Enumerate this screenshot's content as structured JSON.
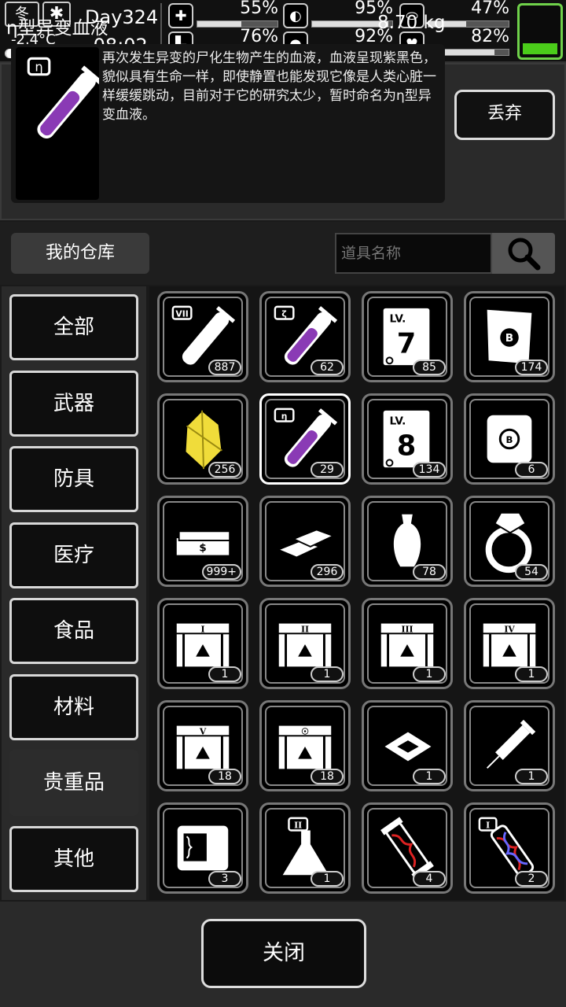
{
  "status": {
    "season": "冬",
    "weather_icon": "snowflake-icon",
    "temperature": "-2.4°C",
    "day": "Day324",
    "time": "-08:02-",
    "stats": [
      {
        "icon": "medkit-icon",
        "label": "55%",
        "level": 0.55
      },
      {
        "icon": "stomach-icon",
        "label": "95%",
        "level": 0.95
      },
      {
        "icon": "pill-icon",
        "label": "47%",
        "level": 0.47
      },
      {
        "icon": "boot-icon",
        "label": "76%",
        "level": 0.76
      },
      {
        "icon": "water-drop-icon",
        "label": "92%",
        "level": 0.92
      },
      {
        "icon": "heart-icon",
        "label": "82%",
        "level": 0.82
      }
    ],
    "battery_level": 0.25,
    "battery_color": "#4bcc1a"
  },
  "detail": {
    "name": "η型异变血液",
    "weight": "8.70 kg",
    "description": "再次发生异变的尸化生物产生的血液，血液呈现紫黑色，貌似具有生命一样，即使静置也能发现它像是人类心脏一样缓缓跳动，目前对于它的研究太少，暂时命名为η型异变血液。",
    "discard_label": "丢弃"
  },
  "warehouse": {
    "title": "我的仓库",
    "search_placeholder": "道具名称"
  },
  "categories": [
    "全部",
    "武器",
    "防具",
    "医疗",
    "食品",
    "材料",
    "贵重品",
    "其他"
  ],
  "active_category": "贵重品",
  "items": [
    {
      "icon": "vial-vii-icon",
      "count": "887"
    },
    {
      "icon": "vial-zeta-icon",
      "count": "62"
    },
    {
      "icon": "skillbook-lv7-icon",
      "count": "85"
    },
    {
      "icon": "bounty-map-icon",
      "count": "174"
    },
    {
      "icon": "gold-crystal-icon",
      "count": "256"
    },
    {
      "icon": "vial-eta-icon",
      "count": "29"
    },
    {
      "icon": "skillbook-lv8-icon",
      "count": "134"
    },
    {
      "icon": "scroll-icon",
      "count": "6"
    },
    {
      "icon": "cash-stack-icon",
      "count": "999+"
    },
    {
      "icon": "gold-bars-icon",
      "count": "296"
    },
    {
      "icon": "vase-icon",
      "count": "78"
    },
    {
      "icon": "diamond-ring-icon",
      "count": "54"
    },
    {
      "icon": "crate-i-icon",
      "count": "1"
    },
    {
      "icon": "crate-ii-icon",
      "count": "1"
    },
    {
      "icon": "crate-iii-icon",
      "count": "1"
    },
    {
      "icon": "crate-iv-icon",
      "count": "1"
    },
    {
      "icon": "crate-v-icon",
      "count": "18"
    },
    {
      "icon": "locked-crate-icon",
      "count": "18"
    },
    {
      "icon": "microchip-icon",
      "count": "1"
    },
    {
      "icon": "syringe-icon",
      "count": "1"
    },
    {
      "icon": "device-icon",
      "count": "3"
    },
    {
      "icon": "flask-ii-icon",
      "count": "1"
    },
    {
      "icon": "dna-capsule-red-icon",
      "count": "4"
    },
    {
      "icon": "dna-capsule-i-icon",
      "count": "2"
    }
  ],
  "selected_item_index": 5,
  "close_label": "关闭"
}
